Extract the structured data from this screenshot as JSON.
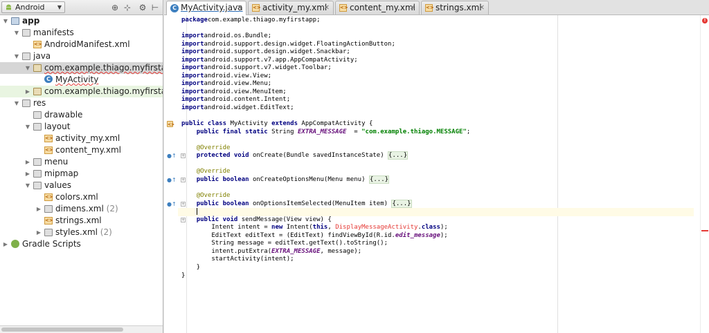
{
  "project_panel": {
    "view_selector": "Android",
    "toolbar_icons": [
      "sync-icon",
      "collapse-all-icon",
      "settings-icon",
      "hide-icon"
    ],
    "tree": [
      {
        "label": "app",
        "bold": true,
        "depth": 0,
        "toggle": "open",
        "icon": "module"
      },
      {
        "label": "manifests",
        "depth": 1,
        "toggle": "open",
        "icon": "folder"
      },
      {
        "label": "AndroidManifest.xml",
        "depth": 2,
        "toggle": "",
        "icon": "xml"
      },
      {
        "label": "java",
        "depth": 1,
        "toggle": "open",
        "icon": "folder"
      },
      {
        "label": "com.example.thiago.myfirstapp",
        "depth": 2,
        "toggle": "open",
        "icon": "package",
        "state": "selected",
        "error": true
      },
      {
        "label": "MyActivity",
        "depth": 3,
        "toggle": "",
        "icon": "class",
        "error": true
      },
      {
        "label": "com.example.thiago.myfirstapp",
        "depth": 2,
        "toggle": "closed",
        "icon": "package",
        "state": "highlight"
      },
      {
        "label": "res",
        "depth": 1,
        "toggle": "open",
        "icon": "folder"
      },
      {
        "label": "drawable",
        "depth": 2,
        "toggle": "",
        "icon": "folder"
      },
      {
        "label": "layout",
        "depth": 2,
        "toggle": "open",
        "icon": "folder"
      },
      {
        "label": "activity_my.xml",
        "depth": 3,
        "toggle": "",
        "icon": "xml"
      },
      {
        "label": "content_my.xml",
        "depth": 3,
        "toggle": "",
        "icon": "xml"
      },
      {
        "label": "menu",
        "depth": 2,
        "toggle": "closed",
        "icon": "folder"
      },
      {
        "label": "mipmap",
        "depth": 2,
        "toggle": "closed",
        "icon": "folder"
      },
      {
        "label": "values",
        "depth": 2,
        "toggle": "open",
        "icon": "folder"
      },
      {
        "label": "colors.xml",
        "depth": 3,
        "toggle": "",
        "icon": "xml"
      },
      {
        "label": "dimens.xml",
        "count": "(2)",
        "depth": 3,
        "toggle": "closed",
        "icon": "folder"
      },
      {
        "label": "strings.xml",
        "depth": 3,
        "toggle": "",
        "icon": "xml"
      },
      {
        "label": "styles.xml",
        "count": "(2)",
        "depth": 3,
        "toggle": "closed",
        "icon": "folder"
      },
      {
        "label": "Gradle Scripts",
        "depth": 0,
        "toggle": "closed",
        "icon": "gradle"
      }
    ]
  },
  "editor": {
    "tabs": [
      {
        "label": "MyActivity.java",
        "icon": "class",
        "active": true
      },
      {
        "label": "activity_my.xml",
        "icon": "xml"
      },
      {
        "label": "content_my.xml",
        "icon": "xml"
      },
      {
        "label": "strings.xml",
        "icon": "xml"
      }
    ],
    "lines": [
      [
        [
          "kw",
          "package"
        ],
        [
          "",
          "com.example.thiago.myfirstapp;"
        ]
      ],
      [],
      [
        [
          "kw",
          "import"
        ],
        [
          "",
          "android.os.Bundle;"
        ]
      ],
      [
        [
          "kw",
          "import"
        ],
        [
          "",
          "android.support.design.widget.FloatingActionButton;"
        ]
      ],
      [
        [
          "kw",
          "import"
        ],
        [
          "",
          "android.support.design.widget.Snackbar;"
        ]
      ],
      [
        [
          "kw",
          "import"
        ],
        [
          "",
          "android.support.v7.app.AppCompatActivity;"
        ]
      ],
      [
        [
          "kw",
          "import"
        ],
        [
          "",
          "android.support.v7.widget.Toolbar;"
        ]
      ],
      [
        [
          "kw",
          "import"
        ],
        [
          "",
          "android.view.View;"
        ]
      ],
      [
        [
          "kw",
          "import"
        ],
        [
          "",
          "android.view.Menu;"
        ]
      ],
      [
        [
          "kw",
          "import"
        ],
        [
          "",
          "android.view.MenuItem;"
        ]
      ],
      [
        [
          "kw",
          "import"
        ],
        [
          "",
          "android.content.Intent;"
        ]
      ],
      [
        [
          "kw",
          "import"
        ],
        [
          "",
          "android.widget.EditText;"
        ]
      ],
      [],
      [
        [
          "kw",
          "public class "
        ],
        [
          "",
          "MyActivity "
        ],
        [
          "kw",
          "extends "
        ],
        [
          "",
          "AppCompatActivity {"
        ]
      ],
      [
        [
          "",
          "    "
        ],
        [
          "kw",
          "public final static "
        ],
        [
          "",
          "String "
        ],
        [
          "fld",
          "EXTRA_MESSAGE"
        ],
        [
          "",
          "  = "
        ],
        [
          "str",
          "\"com.example.thiago.MESSAGE\""
        ],
        [
          "",
          ";"
        ]
      ],
      [],
      [
        [
          "",
          "    "
        ],
        [
          "ann",
          "@Override"
        ]
      ],
      [
        [
          "",
          "    "
        ],
        [
          "kw",
          "protected void "
        ],
        [
          "",
          "onCreate(Bundle savedInstanceState) "
        ],
        [
          "fold",
          "{...}"
        ]
      ],
      [],
      [
        [
          "",
          "    "
        ],
        [
          "ann",
          "@Override"
        ]
      ],
      [
        [
          "",
          "    "
        ],
        [
          "kw",
          "public boolean "
        ],
        [
          "",
          "onCreateOptionsMenu(Menu menu) "
        ],
        [
          "fold",
          "{...}"
        ]
      ],
      [],
      [
        [
          "",
          "    "
        ],
        [
          "ann",
          "@Override"
        ]
      ],
      [
        [
          "",
          "    "
        ],
        [
          "kw",
          "public boolean "
        ],
        [
          "",
          "onOptionsItemSelected(MenuItem item) "
        ],
        [
          "fold",
          "{...}"
        ]
      ],
      [
        [
          "",
          "    "
        ],
        [
          "caret",
          ""
        ]
      ],
      [
        [
          "",
          "    "
        ],
        [
          "kw",
          "public void "
        ],
        [
          "",
          "sendMessage(View view) {"
        ]
      ],
      [
        [
          "",
          "        Intent intent = "
        ],
        [
          "kw",
          "new "
        ],
        [
          "",
          "Intent("
        ],
        [
          "kw",
          "this"
        ],
        [
          "",
          ", "
        ],
        [
          "err",
          "DisplayMessageActivity"
        ],
        [
          "",
          "."
        ],
        [
          "kw",
          "class"
        ],
        [
          "",
          ");"
        ]
      ],
      [
        [
          "",
          "        EditText editText = (EditText) findViewById(R.id."
        ],
        [
          "fld",
          "edit_message"
        ],
        [
          "",
          ");"
        ]
      ],
      [
        [
          "",
          "        String message = editText.getText().toString();"
        ]
      ],
      [
        [
          "",
          "        intent.putExtra("
        ],
        [
          "fld",
          "EXTRA_MESSAGE"
        ],
        [
          "",
          ", message);"
        ]
      ],
      [
        [
          "",
          "        startActivity(intent);"
        ]
      ],
      [
        [
          "",
          "    }"
        ]
      ],
      [
        [
          "",
          "}"
        ]
      ]
    ],
    "current_line": 24,
    "gutter_marks": [
      {
        "line": 13,
        "type": "class"
      },
      {
        "line": 17,
        "type": "override"
      },
      {
        "line": 20,
        "type": "override"
      },
      {
        "line": 23,
        "type": "override"
      }
    ],
    "fold_marks": [
      17,
      20,
      23,
      25
    ],
    "error_stripe": "error",
    "colors": {
      "keyword": "#000080",
      "string": "#008000",
      "annotation": "#808000",
      "field": "#660e7a",
      "error": "#e53935"
    }
  }
}
